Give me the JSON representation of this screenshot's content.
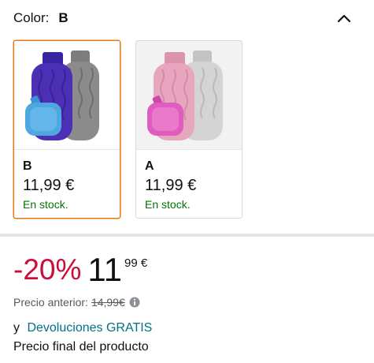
{
  "color": {
    "label": "Color:",
    "selected_value": "B"
  },
  "swatches": [
    {
      "name": "B",
      "price": "11,99 €",
      "stock": "En stock.",
      "selected": true,
      "image_icon": "hot-water-bottle-purple-gray-icon",
      "colors": [
        "#4b2fb5",
        "#8b8b8b",
        "#4fa7e0"
      ]
    },
    {
      "name": "A",
      "price": "11,99 €",
      "stock": "En stock.",
      "selected": false,
      "image_icon": "hot-water-bottle-pink-white-icon",
      "colors": [
        "#e7a6bd",
        "#cfcfcf",
        "#e05cbf"
      ]
    }
  ],
  "price": {
    "discount": "-20%",
    "whole": "11",
    "fraction": "99 €",
    "list_label": "Precio anterior:",
    "list_value": "14,99€"
  },
  "returns": {
    "prefix": "y",
    "link": "Devoluciones GRATIS"
  },
  "final_label": "Precio final del producto",
  "accent_colors": {
    "selected_border": "#e47911",
    "discount": "#cc0c39",
    "in_stock": "#007600",
    "link": "#007185"
  }
}
